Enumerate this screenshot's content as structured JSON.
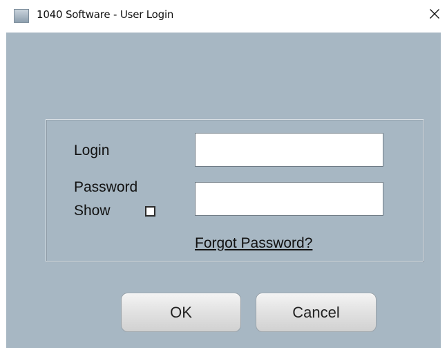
{
  "window": {
    "title": "1040 Software - User Login",
    "icons": {
      "app": "app-icon",
      "close": "close-icon"
    }
  },
  "form": {
    "login_label": "Login",
    "login_value": "",
    "password_label": "Password",
    "password_value": "",
    "show_label": "Show",
    "show_checked": false,
    "forgot_link": "Forgot Password?"
  },
  "buttons": {
    "ok_label": "OK",
    "cancel_label": "Cancel"
  },
  "colors": {
    "client_background": "#a7b7c3",
    "title_background": "#ffffff"
  }
}
